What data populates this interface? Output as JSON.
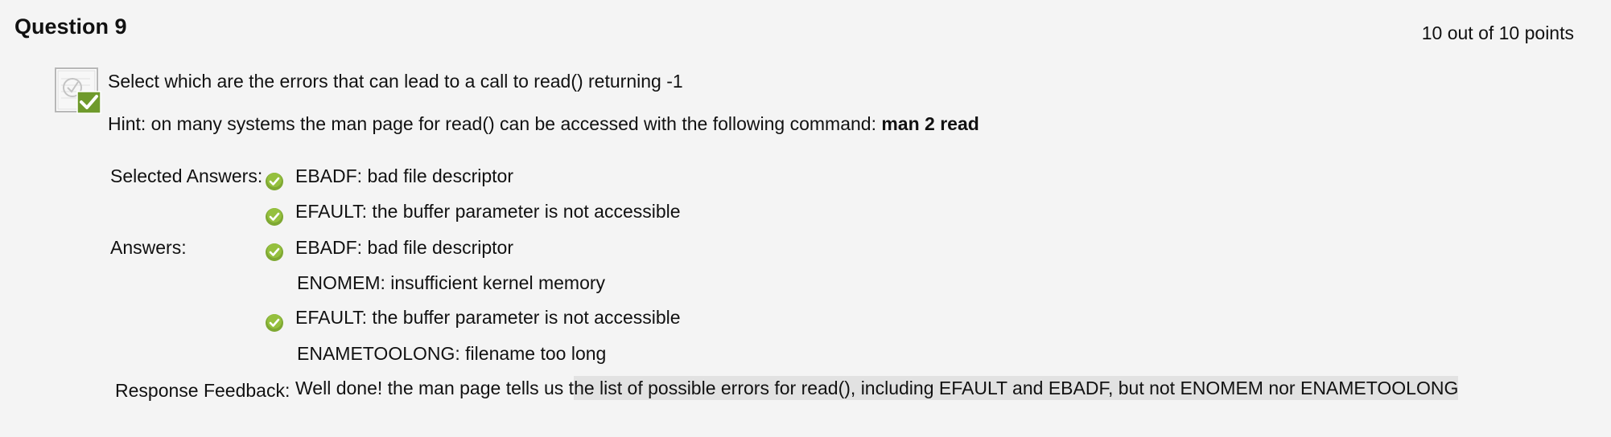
{
  "question": {
    "title": "Question 9",
    "points": "10 out of 10 points",
    "text": "Select which are the errors that can lead to a call to read() returning -1",
    "hint_prefix": "Hint: on many systems the man page for read() can be accessed with the following command: ",
    "hint_command": "man 2 read"
  },
  "selected_label": "Selected Answers:",
  "answers_label": "Answers:",
  "selected_answers": [
    {
      "text": "EBADF: bad file descriptor",
      "correct": true
    },
    {
      "text": "EFAULT: the buffer parameter is not accessible",
      "correct": true
    }
  ],
  "answers": [
    {
      "text": "EBADF: bad file descriptor",
      "correct": true
    },
    {
      "text": "ENOMEM: insufficient kernel memory",
      "correct": false
    },
    {
      "text": "EFAULT: the buffer parameter is not accessible",
      "correct": true
    },
    {
      "text": "ENAMETOOLONG: filename too long",
      "correct": false
    }
  ],
  "feedback": {
    "label": "Response Feedback:",
    "text_plain": "Well done! the man page tells us t",
    "text_highlighted": "he list of possible errors for read(), including EFAULT and EBADF, but not ENOMEM nor ENAMETOOLONG"
  },
  "colors": {
    "background": "#f4f4f4",
    "check_green": "#7ea832",
    "highlight": "#e2e2e2"
  }
}
